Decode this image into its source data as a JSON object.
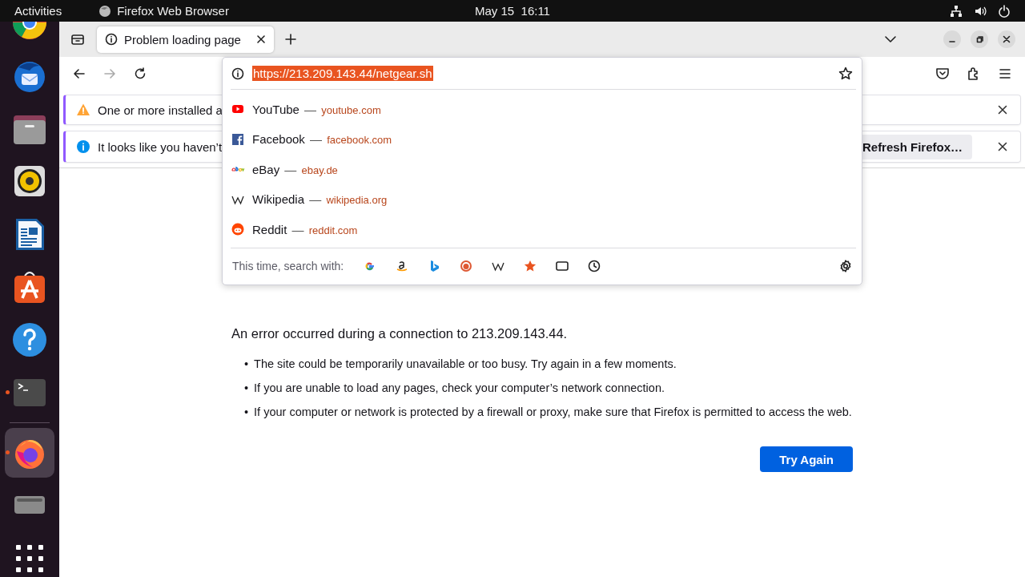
{
  "top_bar": {
    "activities": "Activities",
    "app_name": "Firefox Web Browser",
    "clock": "May 15  16:11"
  },
  "dock": {
    "groups": [
      {
        "items": [
          {
            "kind": "chrome",
            "running": false,
            "selected": false
          },
          {
            "kind": "mail",
            "running": false,
            "selected": false
          },
          {
            "kind": "files",
            "running": false,
            "selected": false
          },
          {
            "kind": "music",
            "running": false,
            "selected": false
          },
          {
            "kind": "writer",
            "running": false,
            "selected": false
          },
          {
            "kind": "store",
            "running": false,
            "selected": false
          },
          {
            "kind": "help",
            "running": false,
            "selected": false
          },
          {
            "kind": "terminal",
            "running": true,
            "selected": false
          }
        ]
      },
      {
        "items": [
          {
            "kind": "firefox",
            "running": true,
            "selected": true
          },
          {
            "kind": "drive",
            "running": false,
            "selected": false
          },
          {
            "kind": "grid",
            "running": false,
            "selected": false
          }
        ]
      }
    ]
  },
  "tabs": [
    {
      "label": "Problem loading page",
      "selected": true
    }
  ],
  "nav": {
    "buttons": [
      {
        "kind": "back",
        "disabled": false
      },
      {
        "kind": "forward",
        "disabled": true
      },
      {
        "kind": "reload",
        "disabled": false
      }
    ]
  },
  "notifications": [
    {
      "kind": "warning",
      "text": "One or more installed a"
    },
    {
      "kind": "info",
      "text": "It looks like you haven’t",
      "button": "Refresh Firefox…"
    }
  ],
  "url_popup": {
    "url_field": {
      "value": "https://213.209.143.44/netgear.sh",
      "selected": true
    },
    "suggestions": [
      {
        "kind": "youtube",
        "title": "YouTube",
        "separator": "—",
        "url": "youtube.com"
      },
      {
        "kind": "facebook",
        "title": "Facebook",
        "separator": "—",
        "url": "facebook.com"
      },
      {
        "kind": "ebay",
        "title": "eBay",
        "separator": "—",
        "url": "ebay.de"
      },
      {
        "kind": "wikipedia",
        "title": "Wikipedia",
        "separator": "—",
        "url": "wikipedia.org"
      },
      {
        "kind": "reddit",
        "title": "Reddit",
        "separator": "—",
        "url": "reddit.com"
      }
    ],
    "search_label": "This time, search with:",
    "engines": [
      {
        "kind": "google"
      },
      {
        "kind": "amazon"
      },
      {
        "kind": "bing"
      },
      {
        "kind": "duckduckgo"
      },
      {
        "kind": "wikipedia"
      },
      {
        "kind": "bookmarks"
      },
      {
        "kind": "tabs"
      },
      {
        "kind": "history"
      }
    ]
  },
  "error_page": {
    "description": "An error occurred during a connection to 213.209.143.44.",
    "bullets": [
      {
        "marker": "•",
        "text": "The site could be temporarily unavailable or too busy. Try again in a few moments."
      },
      {
        "marker": "•",
        "text": "If you are unable to load any pages, check your computer’s network connection."
      },
      {
        "marker": "•",
        "text": "If your computer or network is protected by a firewall or proxy, make sure that Firefox is permitted to access the web."
      }
    ],
    "button": "Try Again"
  }
}
